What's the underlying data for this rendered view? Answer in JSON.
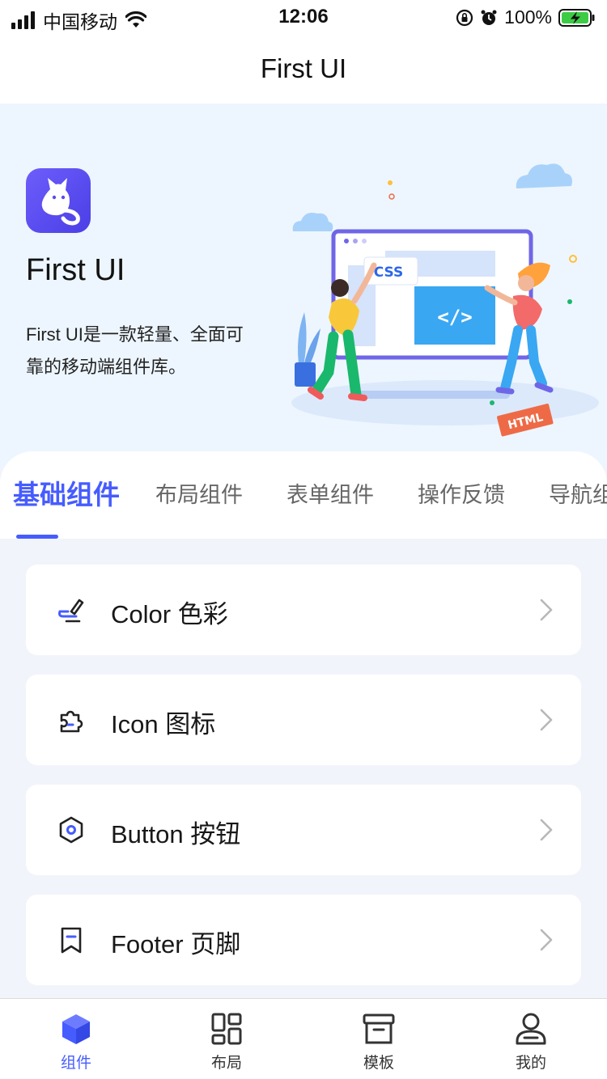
{
  "status_bar": {
    "carrier": "中国移动",
    "time": "12:06",
    "battery_percent": "100%",
    "icons": [
      "signal-icon",
      "wifi-icon",
      "orientation-lock-icon",
      "alarm-icon",
      "battery-charging-icon"
    ]
  },
  "nav": {
    "title": "First UI"
  },
  "hero": {
    "title": "First UI",
    "description": "First UI是一款轻量、全面可靠的移动端组件库。",
    "illustration_labels": {
      "css": "CSS",
      "code": "</>",
      "html": "HTML"
    }
  },
  "tabs": [
    {
      "label": "基础组件",
      "active": true
    },
    {
      "label": "布局组件",
      "active": false
    },
    {
      "label": "表单组件",
      "active": false
    },
    {
      "label": "操作反馈",
      "active": false
    },
    {
      "label": "导航组件",
      "active": false
    }
  ],
  "list": [
    {
      "label": "Color 色彩",
      "icon": "color-brush-icon"
    },
    {
      "label": "Icon 图标",
      "icon": "puzzle-icon"
    },
    {
      "label": "Button 按钮",
      "icon": "hexagon-icon"
    },
    {
      "label": "Footer 页脚",
      "icon": "bookmark-icon"
    }
  ],
  "tabbar": [
    {
      "label": "组件",
      "icon": "cube-icon",
      "active": true
    },
    {
      "label": "布局",
      "icon": "layout-grid-icon",
      "active": false
    },
    {
      "label": "模板",
      "icon": "archive-box-icon",
      "active": false
    },
    {
      "label": "我的",
      "icon": "user-icon",
      "active": false
    }
  ],
  "colors": {
    "accent": "#465cff",
    "hero_bg": "#edf6fe",
    "page_bg": "#f1f4fa"
  }
}
